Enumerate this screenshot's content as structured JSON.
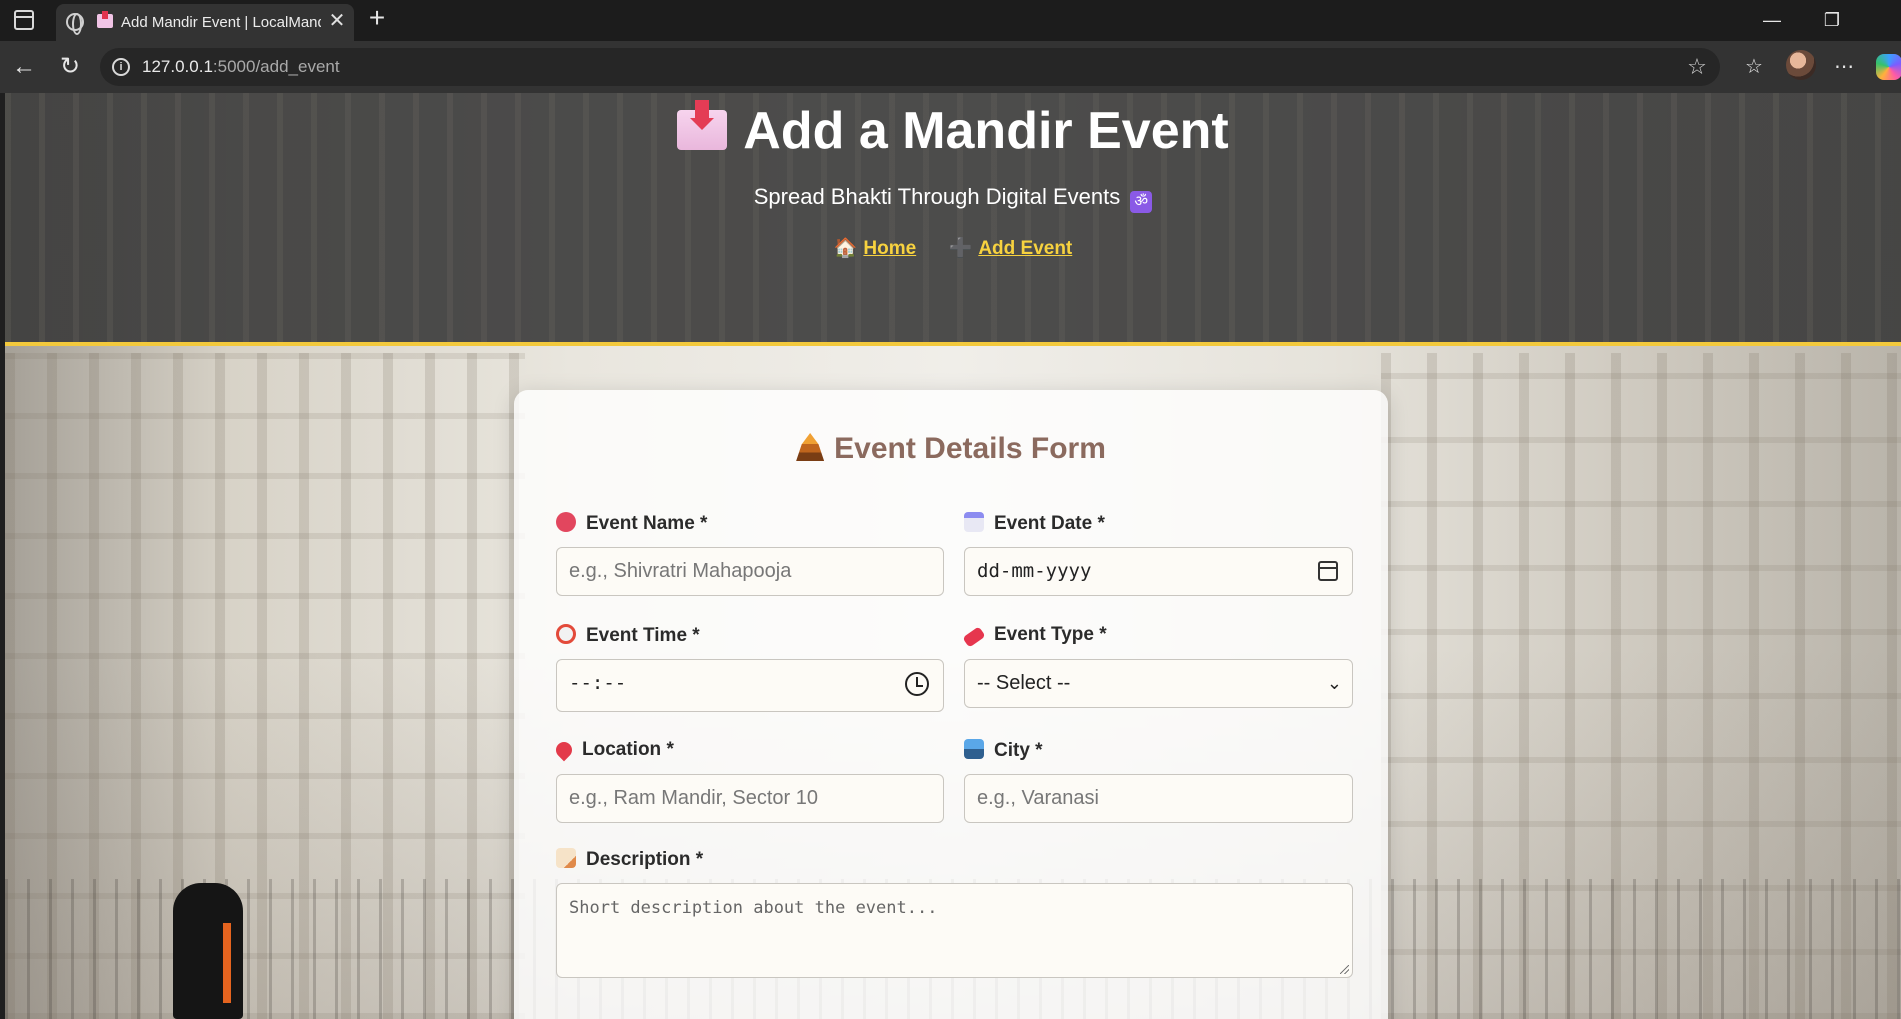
{
  "browser": {
    "tab_title": "Add Mandir Event | LocalMandir",
    "url_host": "127.0.0.1",
    "url_path": ":5000/add_event",
    "new_tab": "+",
    "close_tab": "✕",
    "icons": [
      "sidebar-icon",
      "globe-icon",
      "favicon-icon",
      "back-icon",
      "reload-icon",
      "info-icon",
      "star-icon",
      "favorites-icon",
      "more-icon",
      "avatar",
      "copilot-icon"
    ]
  },
  "header": {
    "title": "Add a Mandir Event",
    "tagline": "Spread Bhakti Through Digital Events",
    "tagline_badge": "ॐ",
    "nav": [
      {
        "icon": "🏠",
        "label": "Home"
      },
      {
        "icon": "➕",
        "label": "Add Event"
      }
    ],
    "accent_color": "#f3c93c"
  },
  "form": {
    "title": "Event Details Form",
    "fields": {
      "event_name": {
        "label": "Event Name *",
        "placeholder": "e.g., Shivratri Mahapooja"
      },
      "event_date": {
        "label": "Event Date *",
        "value": "dd-mm-yyyy"
      },
      "event_time": {
        "label": "Event Time *",
        "value": "--:--"
      },
      "event_type": {
        "label": "Event Type *",
        "value": "-- Select --"
      },
      "location": {
        "label": "Location *",
        "placeholder": "e.g., Ram Mandir, Sector 10"
      },
      "city": {
        "label": "City *",
        "placeholder": "e.g., Varanasi"
      },
      "description": {
        "label": "Description *",
        "placeholder": "Short description about the event..."
      }
    },
    "title_color": "#8b6a5e"
  }
}
